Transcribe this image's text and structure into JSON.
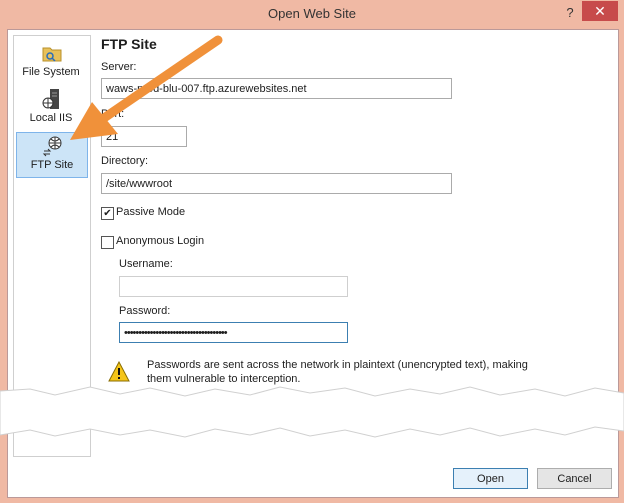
{
  "window": {
    "title": "Open Web Site",
    "help": "?",
    "close": "✕"
  },
  "sidebar": {
    "items": [
      {
        "label": "File System"
      },
      {
        "label": "Local IIS"
      },
      {
        "label": "FTP Site"
      }
    ]
  },
  "form": {
    "heading": "FTP Site",
    "server_label": "Server:",
    "server_value": "waws-prod-blu-007.ftp.azurewebsites.net",
    "port_label": "Port:",
    "port_value": "21",
    "directory_label": "Directory:",
    "directory_value": "/site/wwwroot",
    "passive_label": "Passive Mode",
    "passive_checked": "✔",
    "anonymous_label": "Anonymous Login",
    "username_label": "Username:",
    "username_value": "",
    "password_label": "Password:",
    "password_value": "••••••••••••••••••••••••••••••••••••",
    "warning_text": "Passwords are sent across the network in plaintext (unencrypted text), making them vulnerable to interception."
  },
  "buttons": {
    "open": "Open",
    "cancel": "Cancel"
  },
  "colors": {
    "arrow": "#f0913a",
    "selected": "#cce4f7",
    "title_bg": "#f0b9a4",
    "close": "#c74b4b"
  }
}
